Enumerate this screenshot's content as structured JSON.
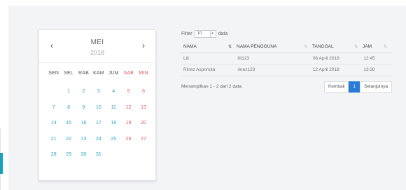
{
  "calendar": {
    "month": "MEI",
    "year": "2018",
    "prev_icon": "‹",
    "next_icon": "›",
    "weekdays": [
      "SEN",
      "SEL",
      "RAB",
      "KAM",
      "JUM",
      "SAB",
      "MIN"
    ],
    "leading_blanks": 1,
    "days": [
      "1",
      "2",
      "3",
      "4",
      "5",
      "6",
      "7",
      "8",
      "9",
      "10",
      "11",
      "12",
      "13",
      "14",
      "15",
      "16",
      "17",
      "18",
      "19",
      "20",
      "21",
      "22",
      "23",
      "24",
      "25",
      "26",
      "27",
      "28",
      "29",
      "30",
      "31"
    ]
  },
  "filter": {
    "label": "Filter",
    "value": "10",
    "suffix": "data"
  },
  "table": {
    "headers": [
      "NAMA",
      "NAMA PENGGUNA",
      "TANGGAL",
      "JAM"
    ],
    "sort_icon": "⇅",
    "rows": [
      [
        "Lili",
        "lili123",
        "08 April 2018",
        "12:45"
      ],
      [
        "Rinez Asprinola",
        "rinez123",
        "12 April 2018",
        "13:30"
      ]
    ]
  },
  "info": "Menampilkan 1 - 2 dari 2 data",
  "pager": {
    "prev": "Kembali",
    "current": "1",
    "next": "Selanjutnya"
  },
  "colors": {
    "accent": "#17a2b8",
    "day": "#2ea8c9",
    "weekend": "#e15a5a",
    "page_active": "#2a7bd6"
  }
}
